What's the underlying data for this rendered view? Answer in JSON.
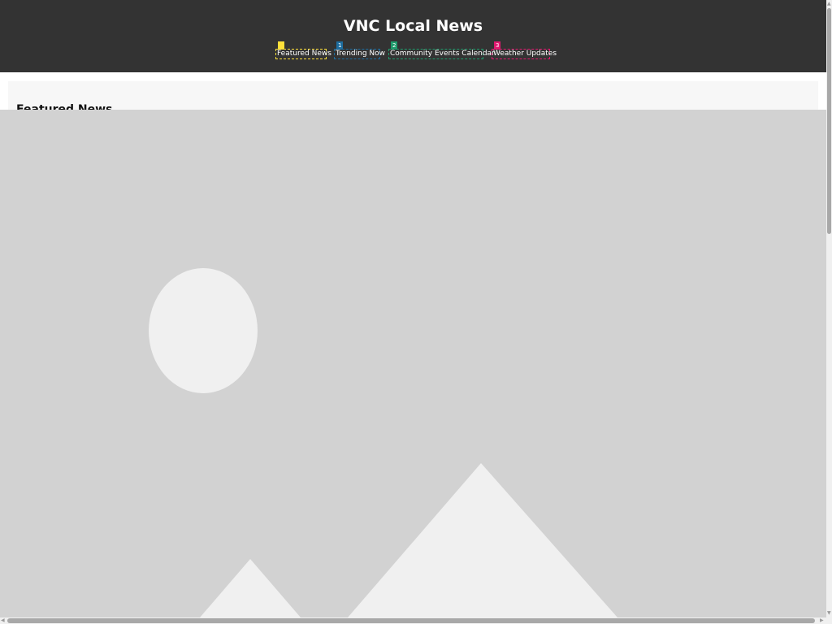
{
  "header": {
    "title": "VNC Local News",
    "background": "#333333"
  },
  "nav": {
    "items": [
      {
        "label": "Featured News",
        "badge": "",
        "color": "#ffe03a",
        "badge_text_color": "#333333"
      },
      {
        "label": "Trending Now",
        "badge": "1",
        "color": "#1e6ea0",
        "badge_text_color": "#ffffff"
      },
      {
        "label": "Community Events Calendar",
        "badge": "2",
        "color": "#1f9a6b",
        "badge_text_color": "#ffffff"
      },
      {
        "label": "Weather Updates",
        "badge": "3",
        "color": "#e0196f",
        "badge_text_color": "#ffffff"
      }
    ]
  },
  "main": {
    "section_heading": "Featured News",
    "image_icon": "image-placeholder-icon"
  },
  "scrollbars": {
    "up_arrow": "▲",
    "down_arrow": "▼",
    "left_arrow": "◀",
    "right_arrow": "▶"
  }
}
